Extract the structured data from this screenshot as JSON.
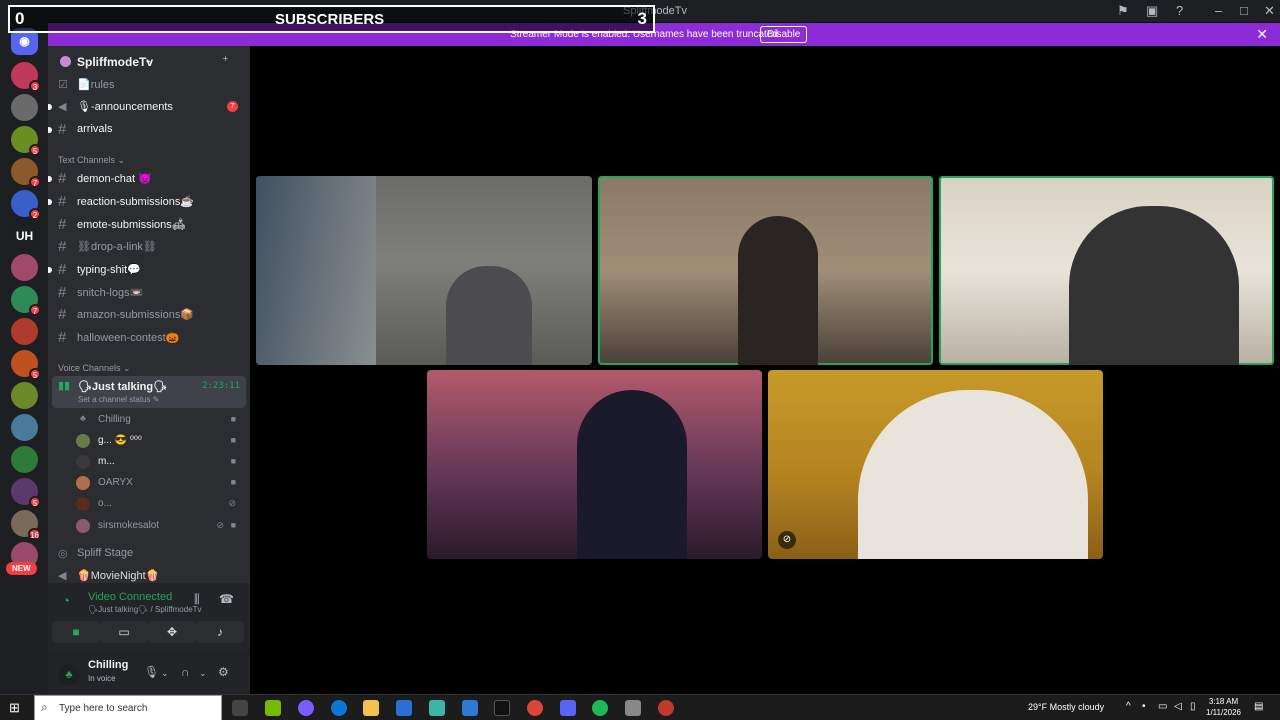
{
  "window": {
    "title": "SpliffmodeTv"
  },
  "overlay": {
    "left": "0",
    "center": "SUBSCRIBERS",
    "right": "3"
  },
  "banner": {
    "text": "Streamer Mode is enabled. Usernames have been truncated.",
    "button": "Disable"
  },
  "server": {
    "name": "SpliffmodeTv"
  },
  "guild_rail": {
    "badges": [
      "3",
      "5",
      "7",
      "2",
      "7",
      "5",
      "5",
      "16"
    ],
    "text_guild": "UH",
    "new_label": "NEW"
  },
  "channels": {
    "top": [
      {
        "label": "📄rules",
        "mention": ""
      },
      {
        "label": "🎙-announcements",
        "mention": "7"
      },
      {
        "label": "arrivals",
        "mention": ""
      }
    ],
    "text_category": "Text Channels",
    "text": [
      {
        "label": "demon-chat 👿"
      },
      {
        "label": "reaction-submissions☕"
      },
      {
        "label": "emote-submissions🛋"
      },
      {
        "label": "⛓drop-a-link⛓"
      },
      {
        "label": "typing-shit💬"
      },
      {
        "label": "snitch-logs📼"
      },
      {
        "label": "amazon-submissions📦"
      },
      {
        "label": "halloween-contest🎃"
      }
    ],
    "voice_category": "Voice Channels",
    "voice_active": {
      "label": "🗣Just talking🗣",
      "timer": "2:23:11",
      "status": "Set a channel status ✎"
    },
    "voice_users": [
      {
        "name": "Chilling"
      },
      {
        "name": "g... 😎 ⁰⁰⁰"
      },
      {
        "name": "m..."
      },
      {
        "name": "OARYX"
      },
      {
        "name": "o..."
      },
      {
        "name": "sirsmokesalot"
      }
    ],
    "voice_others": [
      {
        "label": "Spliff Stage"
      },
      {
        "label": "🍿MovieNight🍿"
      }
    ]
  },
  "voice_panel": {
    "status": "Video Connected",
    "location": "🗣Just talking🗣 / SpliffmodeTv"
  },
  "user": {
    "name": "Chilling",
    "status": "In voice"
  },
  "taskbar": {
    "search_placeholder": "Type here to search",
    "weather": "29°F  Mostly cloudy",
    "time": "3:18 AM",
    "date": "1/11/2026"
  },
  "colors": {
    "accent": "#8d2bd8",
    "green": "#23a55a",
    "red": "#f23f43"
  },
  "icons": [
    "windows-start-icon",
    "search-icon",
    "discord-icon",
    "camera-icon",
    "screen-share-icon",
    "activity-icon",
    "soundboard-icon",
    "microphone-icon",
    "headphones-icon",
    "gear-icon",
    "hangup-icon"
  ]
}
